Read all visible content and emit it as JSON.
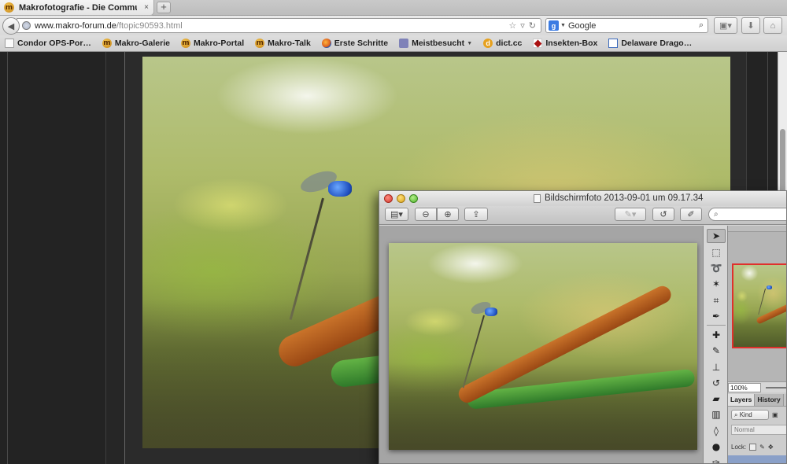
{
  "browser": {
    "tab_title": "Makrofotografie - Die Commun…",
    "tab_close": "×",
    "new_tab": "+",
    "url_host": "www.makro-forum.de",
    "url_path": "/ftopic90593.html",
    "search_placeholder": "Google",
    "search_engine_icon": "google-icon",
    "back_icon": "back-arrow-icon"
  },
  "bookmarks": [
    {
      "label": "Condor OPS-Por…",
      "icon": "page-icon"
    },
    {
      "label": "Makro-Galerie",
      "icon": "makro-forum-icon"
    },
    {
      "label": "Makro-Portal",
      "icon": "makro-forum-icon"
    },
    {
      "label": "Makro-Talk",
      "icon": "makro-forum-icon"
    },
    {
      "label": "Erste Schritte",
      "icon": "firefox-icon"
    },
    {
      "label": "Meistbesucht",
      "icon": "folder-icon"
    },
    {
      "label": "dict.cc",
      "icon": "dictcc-icon"
    },
    {
      "label": "Insekten-Box",
      "icon": "insekten-icon"
    },
    {
      "label": "Delaware Drago…",
      "icon": "page-icon"
    }
  ],
  "preview": {
    "window_title": "Bildschirmfoto 2013-09-01 um 09.17.34"
  },
  "photoshop": {
    "zoom": "100%",
    "tabs": [
      "Layers",
      "History"
    ],
    "kind_label": "Kind",
    "blend_mode": "Normal",
    "lock_label": "Lock:"
  },
  "colors": {
    "accent_red": "#e0302c",
    "page_bg": "#2b2b2b"
  }
}
